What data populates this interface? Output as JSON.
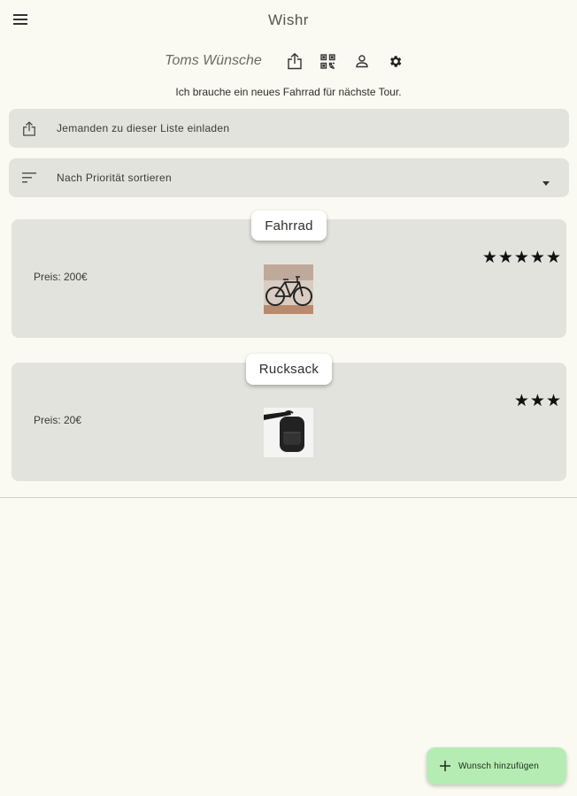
{
  "appbar": {
    "title": "Wishr",
    "menu_icon": "menu-icon"
  },
  "list": {
    "title": "Toms Wünsche",
    "icons": [
      "share-icon",
      "qr-code-icon",
      "person-icon",
      "settings-icon"
    ],
    "description": "Ich brauche ein neues Fahrrad für nächste Tour."
  },
  "invite": {
    "label": "Jemanden zu dieser Liste einladen",
    "icon": "share-icon"
  },
  "sort": {
    "label": "Nach Priorität sortieren",
    "icon": "sort-icon",
    "dropdown_icon": "arrow-drop-down-icon"
  },
  "wishes": [
    {
      "title": "Fahrrad",
      "price": "Preis: 200€",
      "image": "bicycle-photo",
      "stars": "★★★★★",
      "priority": 5
    },
    {
      "title": "Rucksack",
      "price": "Preis: 20€",
      "image": "backpack-photo",
      "stars": "★★★",
      "priority": 3
    }
  ],
  "fab": {
    "label": "Wunsch hinzufügen",
    "icon": "plus-icon",
    "color": "#b5ecb3"
  },
  "colors": {
    "background": "#fafaf2",
    "card": "#e3e3dd",
    "accent": "#b5ecb3"
  }
}
